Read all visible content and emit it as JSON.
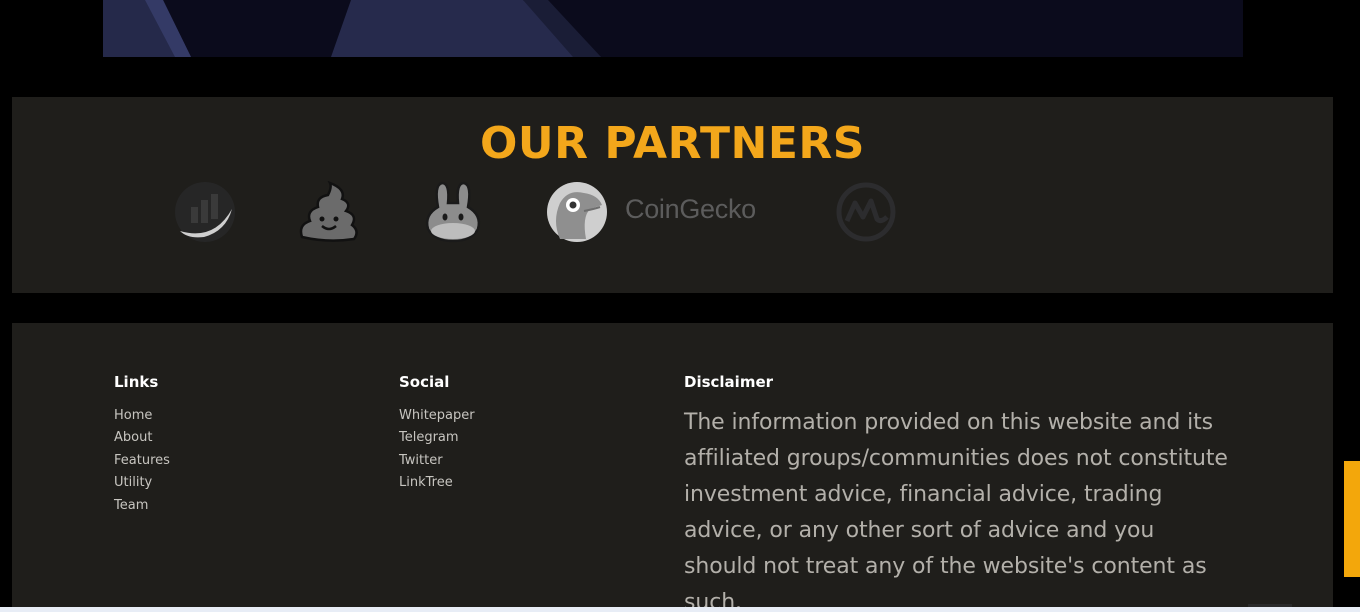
{
  "partners": {
    "title": "OUR PARTNERS",
    "title_color": "#f3a71b",
    "logos": [
      {
        "icon": "dextools-icon"
      },
      {
        "icon": "poocoin-icon"
      },
      {
        "icon": "pancakeswap-icon"
      },
      {
        "icon": "coingecko-icon",
        "wordmark": "CoinGecko"
      },
      {
        "icon": "coinmarketcap-icon"
      }
    ]
  },
  "footer": {
    "links": {
      "title": "Links",
      "items": [
        "Home",
        "About",
        "Features",
        "Utility",
        "Team"
      ]
    },
    "social": {
      "title": "Social",
      "items": [
        "Whitepaper",
        "Telegram",
        "Twitter",
        "LinkTree"
      ]
    },
    "disclaimer": {
      "title": "Disclaimer",
      "text": "The information provided on this website and its affiliated groups/communities does not constitute investment advice, financial advice, trading advice, or any other sort of advice and you should not treat any of the website's content as such."
    }
  },
  "colors": {
    "accent": "#f3a71b",
    "panel": "#1f1e1b",
    "background": "#000000"
  }
}
